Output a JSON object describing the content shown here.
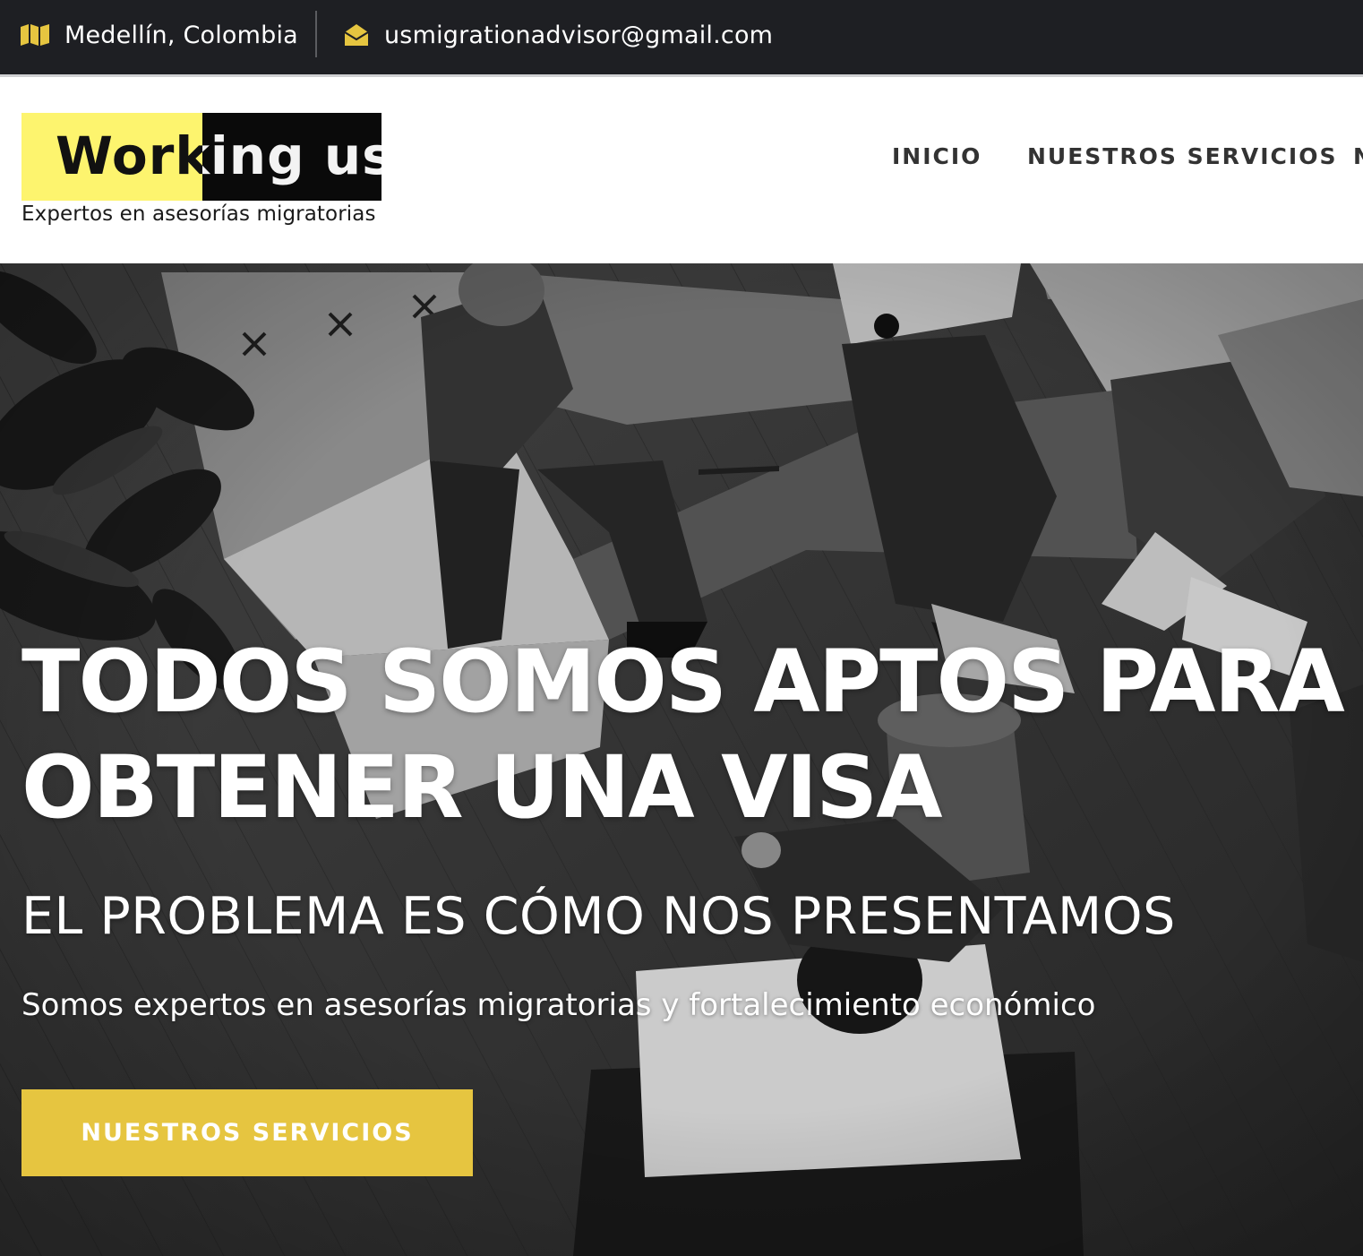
{
  "topbar": {
    "location": "Medellín, Colombia",
    "email": "usmigrationadvisor@gmail.com",
    "location_icon": "map-icon",
    "email_icon": "envelope-open-icon",
    "icon_color": "#e6c540"
  },
  "header": {
    "logo_text": "Working us",
    "tagline": "Expertos en asesorías migratorias",
    "nav": [
      "INICIO",
      "NUESTROS SERVICIOS",
      "N"
    ]
  },
  "hero": {
    "title": "TODOS SOMOS APTOS PARA OBTENER UNA VISA",
    "subtitle": "EL PROBLEMA ES CÓMO NOS PRESENTAMOS",
    "description": "Somos expertos en asesorías migratorias y fortalecimiento económico",
    "cta_label": "NUESTROS SERVICIOS",
    "cta_color": "#e6c540"
  },
  "colors": {
    "topbar_bg": "#1e1f23",
    "logo_yellow": "#fdf46e",
    "logo_black": "#0a0a0a"
  }
}
